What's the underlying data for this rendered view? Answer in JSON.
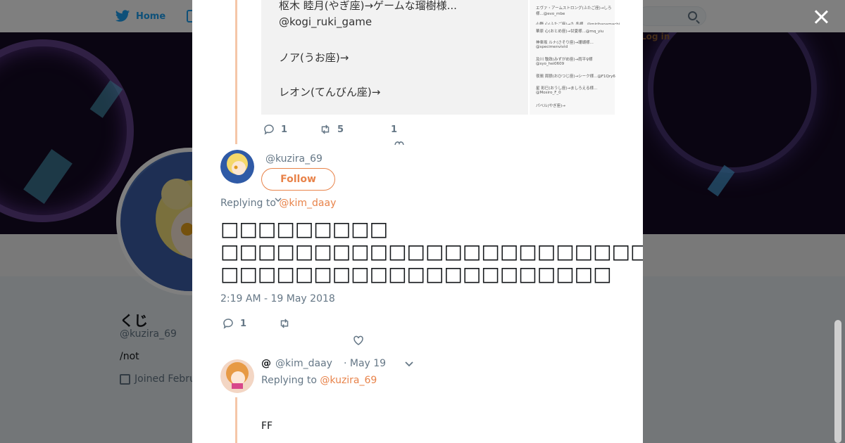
{
  "nav": {
    "home_label": "Home",
    "login_label": "Log in"
  },
  "profile": {
    "name": "くじ",
    "handle": "@kuzira_69",
    "bio": "/not",
    "joined": "Joined Febru"
  },
  "prev_tweet": {
    "media_left_lines": [
      "枢木 睦月(やぎ座)→ゲームな瑠樹様...",
      "@kogi_ruki_game",
      "",
      "ノア(うお座)→",
      "",
      "レオン(てんびん座)→"
    ],
    "media_right_lines": [
      "エヴァ・アームストロング(ふたご座)→しろ",
      "様...@evo_mbe",
      "",
      "小野 心(ふたご座)→九 冬様...@mirihanamachi",
      "華原 心(おとめ座)→甘夏様...@mq_yiu",
      "",
      "神楽坂 ルナ(さそり座)→珊瑚様...",
      "@specimenvivid",
      "",
      "及川 敬政(みずがめ座)→雨平♀様",
      "@syo_hei0609",
      "",
      "夜鴉 周狼(おひつじ座)→シーク様...@F1Qry6",
      "",
      "星 彩巳(おうし座)→ましろえる様...",
      "@Mosiro_F_0",
      "",
      "パベル(やぎ座)→"
    ],
    "reply_count": "1",
    "retweet_count": "5",
    "like_count": "1"
  },
  "main_tweet": {
    "handle": "@kuzira_69",
    "follow_label": "Follow",
    "replying_prefix": "Replying to",
    "replying_to": "@kim_daay",
    "text_lines": [
      "□□□□□□□□□",
      "□□□□□□□□□□□□□□□□□□□□□□□□□",
      "□□□□□□□□□□□□□□□□□□□□□"
    ],
    "timestamp": "2:19 AM - 19 May 2018",
    "reply_count": "1"
  },
  "reply_tweet": {
    "display_name": "@",
    "handle": "@kim_daay",
    "date": "· May 19",
    "replying_prefix": "Replying to",
    "replying_to": "@kuzira_69",
    "text": "FF"
  },
  "colors": {
    "accent": "#e8834a",
    "twitter_blue": "#1da1f2",
    "muted": "#657786",
    "thread_line": "#f5c6a8"
  },
  "icons": [
    "twitter-bird-icon",
    "search-icon",
    "close-icon",
    "reply-icon",
    "retweet-icon",
    "heart-icon",
    "chevron-down-icon",
    "calendar-icon"
  ]
}
